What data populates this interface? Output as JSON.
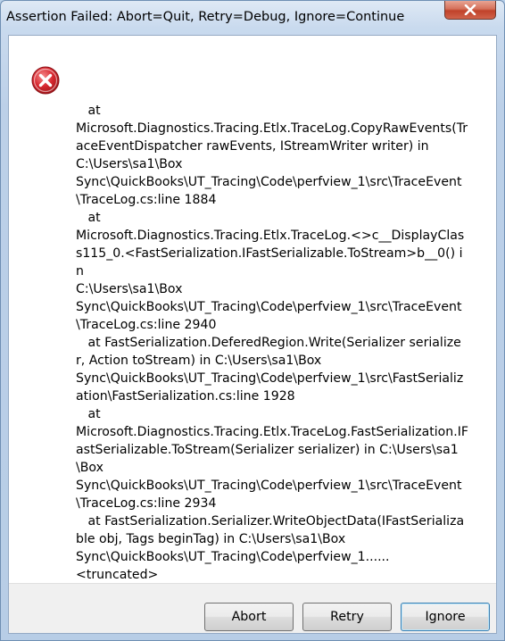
{
  "window": {
    "title": "Assertion Failed: Abort=Quit, Retry=Debug, Ignore=Continue"
  },
  "dialog": {
    "icon": "error-icon",
    "message_lines": [
      "   at",
      "Microsoft.Diagnostics.Tracing.Etlx.TraceLog.CopyRawEvents(TraceEventDispatcher rawEvents, IStreamWriter writer) in",
      "C:\\Users\\sa1\\Box",
      "Sync\\QuickBooks\\UT_Tracing\\Code\\perfview_1\\src\\TraceEvent\\TraceLog.cs:line 1884",
      "   at",
      "Microsoft.Diagnostics.Tracing.Etlx.TraceLog.<>c__DisplayClass115_0.<FastSerialization.IFastSerializable.ToStream>b__0() in",
      "C:\\Users\\sa1\\Box",
      "Sync\\QuickBooks\\UT_Tracing\\Code\\perfview_1\\src\\TraceEvent\\TraceLog.cs:line 2940",
      "   at FastSerialization.DeferedRegion.Write(Serializer serializer, Action toStream) in C:\\Users\\sa1\\Box",
      "Sync\\QuickBooks\\UT_Tracing\\Code\\perfview_1\\src\\FastSerialization\\FastSerialization.cs:line 1928",
      "   at",
      "Microsoft.Diagnostics.Tracing.Etlx.TraceLog.FastSerialization.IFastSerializable.ToStream(Serializer serializer) in C:\\Users\\sa1\\Box",
      "Sync\\QuickBooks\\UT_Tracing\\Code\\perfview_1\\src\\TraceEvent\\TraceLog.cs:line 2934",
      "   at FastSerialization.Serializer.WriteObjectData(IFastSerializable obj, Tags beginTag) in C:\\Users\\sa1\\Box",
      "Sync\\QuickBooks\\UT_Tracing\\Code\\perfview_1......",
      "<truncated>"
    ]
  },
  "buttons": {
    "abort_label": "Abort",
    "retry_label": "Retry",
    "ignore_label": "Ignore"
  },
  "colors": {
    "error_red": "#c8222a",
    "close_button_red": "#c0422a",
    "focus_border": "#3c7fb1"
  }
}
